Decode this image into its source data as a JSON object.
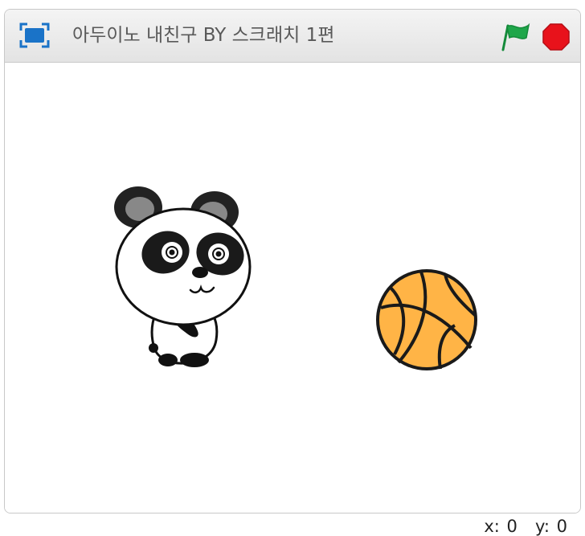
{
  "window": {
    "title": "아두이노 내친구 BY 스크래치 1편"
  },
  "controls": {
    "fullscreen_icon": "fullscreen-icon",
    "flag_icon": "green-flag-icon",
    "stop_icon": "stop-octagon-icon"
  },
  "colors": {
    "accent_blue": "#1a73c8",
    "flag_green": "#1fa64a",
    "stop_red": "#e8121b",
    "ball_orange": "#ffb446"
  },
  "stage": {
    "sprites": [
      {
        "name": "panda",
        "icon": "panda-sprite"
      },
      {
        "name": "basketball",
        "icon": "basketball-sprite"
      }
    ]
  },
  "coordinates": {
    "x_label": "x:",
    "x_value": "0",
    "y_label": "y:",
    "y_value": "0"
  }
}
